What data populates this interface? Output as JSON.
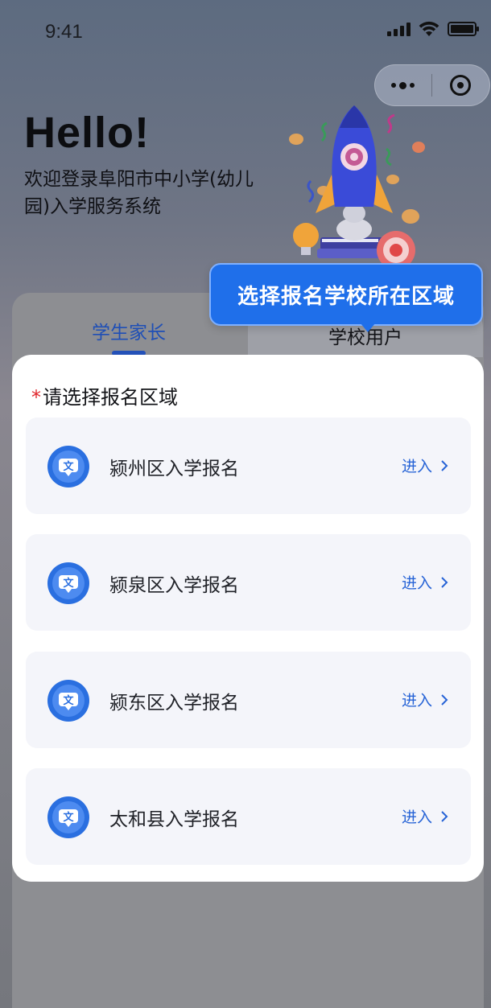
{
  "status_bar": {
    "time": "9:41"
  },
  "hero": {
    "title": "Hello!",
    "subtitle": "欢迎登录阜阳市中小学(幼儿园)入学服务系统"
  },
  "tabs": {
    "parent": "学生家长",
    "school": "学校用户"
  },
  "tooltip": {
    "text": "选择报名学校所在区域"
  },
  "region_card": {
    "required_mark": "*",
    "heading": "请选择报名区域",
    "items": [
      {
        "label": "颍州区入学报名",
        "action": "进入"
      },
      {
        "label": "颍泉区入学报名",
        "action": "进入"
      },
      {
        "label": "颍东区入学报名",
        "action": "进入"
      },
      {
        "label": "太和县入学报名",
        "action": "进入"
      }
    ]
  },
  "colors": {
    "accent": "#2663d6",
    "tooltip_bg": "#1f6fea",
    "required": "#e0252b",
    "item_bg": "#f4f5fa"
  },
  "icons": {
    "region_icon": "school-badge-icon",
    "chevron": "chevron-right-icon"
  }
}
